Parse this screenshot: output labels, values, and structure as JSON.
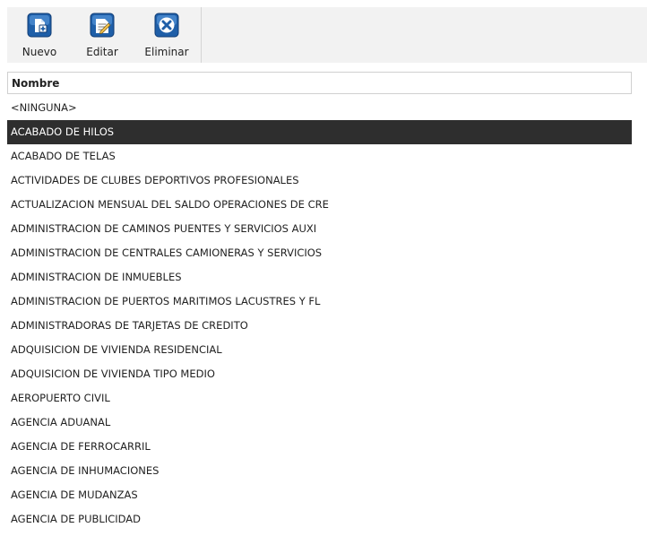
{
  "toolbar": {
    "nuevo_label": "Nuevo",
    "editar_label": "Editar",
    "eliminar_label": "Eliminar"
  },
  "grid": {
    "column_header": "Nombre",
    "selected_index": 1,
    "rows": [
      "<NINGUNA>",
      "ACABADO DE HILOS",
      "ACABADO DE TELAS",
      "ACTIVIDADES DE CLUBES DEPORTIVOS PROFESIONALES",
      "ACTUALIZACION MENSUAL DEL SALDO OPERACIONES DE CRE",
      "ADMINISTRACION DE CAMINOS PUENTES Y SERVICIOS AUXI",
      "ADMINISTRACION DE CENTRALES CAMIONERAS Y SERVICIOS",
      "ADMINISTRACION DE INMUEBLES",
      "ADMINISTRACION DE PUERTOS MARITIMOS LACUSTRES Y FL",
      "ADMINISTRADORAS DE TARJETAS DE CREDITO",
      "ADQUISICION DE VIVIENDA RESIDENCIAL",
      "ADQUISICION DE VIVIENDA TIPO MEDIO",
      "AEROPUERTO CIVIL",
      "AGENCIA ADUANAL",
      "AGENCIA DE FERROCARRIL",
      "AGENCIA DE INHUMACIONES",
      "AGENCIA DE MUDANZAS",
      "AGENCIA DE PUBLICIDAD"
    ]
  },
  "icons": {
    "nuevo": "new-document-icon",
    "editar": "edit-document-icon",
    "eliminar": "delete-x-icon"
  },
  "colors": {
    "selection_bg": "#2e2e2e",
    "selection_text": "#ffffff",
    "icon_blue": "#1f5fa8",
    "toolbar_bg": "#f2f2f2"
  }
}
